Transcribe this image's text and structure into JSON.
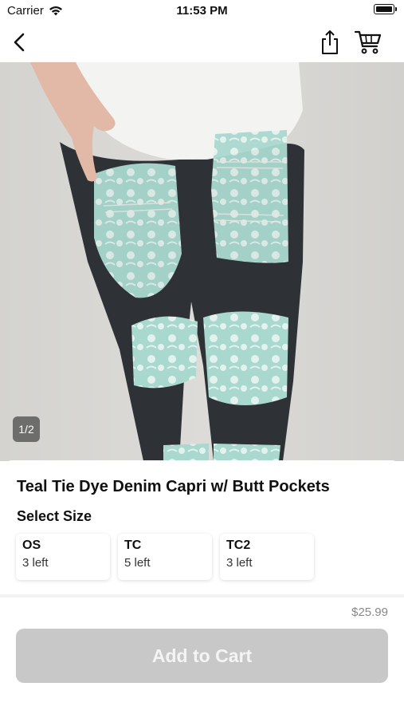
{
  "status_bar": {
    "carrier": "Carrier",
    "time": "11:53 PM"
  },
  "nav": {
    "back_icon": "chevron-left-icon",
    "share_icon": "share-icon",
    "cart_icon": "cart-icon"
  },
  "product": {
    "image_counter": "1/2",
    "title": "Teal Tie Dye Denim Capri w/ Butt Pockets",
    "select_size_label": "Select Size",
    "sizes": [
      {
        "name": "OS",
        "stock": "3 left"
      },
      {
        "name": "TC",
        "stock": "5 left"
      },
      {
        "name": "TC2",
        "stock": "3 left"
      }
    ],
    "price": "$25.99",
    "add_to_cart_label": "Add to Cart"
  },
  "colors": {
    "add_button_bg": "#c8c8c8",
    "pattern_teal": "#a9d8cf",
    "denim": "#2e3236"
  }
}
